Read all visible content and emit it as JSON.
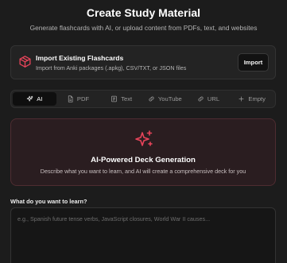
{
  "header": {
    "title": "Create Study Material",
    "subtitle": "Generate flashcards with AI, or upload content from PDFs, text, and websites"
  },
  "import_card": {
    "icon": "package-icon",
    "title": "Import Existing Flashcards",
    "description": "Import from Anki packages (.apkg), CSV/TXT, or JSON files",
    "button_label": "Import"
  },
  "tabs": [
    {
      "label": "AI",
      "icon": "sparkle-icon",
      "active": true
    },
    {
      "label": "PDF",
      "icon": "document-icon",
      "active": false
    },
    {
      "label": "Text",
      "icon": "text-lines-icon",
      "active": false
    },
    {
      "label": "YouTube",
      "icon": "link-icon",
      "active": false
    },
    {
      "label": "URL",
      "icon": "link-icon",
      "active": false
    },
    {
      "label": "Empty",
      "icon": "plus-icon",
      "active": false
    }
  ],
  "hero": {
    "icon": "sparkles-icon",
    "title": "AI-Powered Deck Generation",
    "description": "Describe what you want to learn, and AI will create a comprehensive deck for you"
  },
  "prompt": {
    "label": "What do you want to learn?",
    "value": "",
    "placeholder": "e.g., Spanish future tense verbs, JavaScript closures, World War II causes..."
  },
  "colors": {
    "background": "#1c1c1c",
    "accent": "#e8445a",
    "hero_background": "#2a1d20",
    "hero_border": "#4e2c31"
  }
}
